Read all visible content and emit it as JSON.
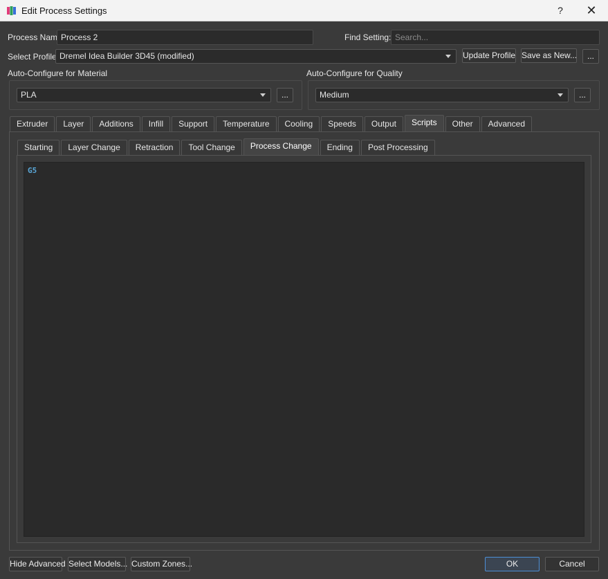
{
  "window": {
    "title": "Edit Process Settings",
    "help": "?",
    "close": "✕"
  },
  "process_name": {
    "label": "Process Name",
    "value": "Process 2"
  },
  "find_setting": {
    "label": "Find Setting:",
    "placeholder": "Search..."
  },
  "profile": {
    "label": "Select Profile",
    "value": "Dremel Idea Builder 3D45 (modified)",
    "update_label": "Update Profile",
    "save_as_label": "Save as New...",
    "more_label": "..."
  },
  "material": {
    "label": "Auto-Configure for Material",
    "value": "PLA",
    "more_label": "..."
  },
  "quality": {
    "label": "Auto-Configure for Quality",
    "value": "Medium",
    "more_label": "..."
  },
  "main_tabs": [
    {
      "label": "Extruder"
    },
    {
      "label": "Layer"
    },
    {
      "label": "Additions"
    },
    {
      "label": "Infill"
    },
    {
      "label": "Support"
    },
    {
      "label": "Temperature"
    },
    {
      "label": "Cooling"
    },
    {
      "label": "Speeds"
    },
    {
      "label": "Output"
    },
    {
      "label": "Scripts"
    },
    {
      "label": "Other"
    },
    {
      "label": "Advanced"
    }
  ],
  "active_main_tab": "Scripts",
  "sub_tabs": [
    {
      "label": "Starting"
    },
    {
      "label": "Layer Change"
    },
    {
      "label": "Retraction"
    },
    {
      "label": "Tool Change"
    },
    {
      "label": "Process Change"
    },
    {
      "label": "Ending"
    },
    {
      "label": "Post Processing"
    }
  ],
  "active_sub_tab": "Process Change",
  "script": {
    "text": "G5"
  },
  "footer": {
    "hide_advanced": "Hide Advanced",
    "select_models": "Select Models...",
    "custom_zones": "Custom Zones...",
    "ok": "OK",
    "cancel": "Cancel"
  },
  "colors": {
    "background": "#3a3a3a",
    "code": "#5aa7d8",
    "accent": "#4d8fd6"
  },
  "icons": {
    "app": "app-logo-icon",
    "dropdown": "chevron-down-icon"
  }
}
